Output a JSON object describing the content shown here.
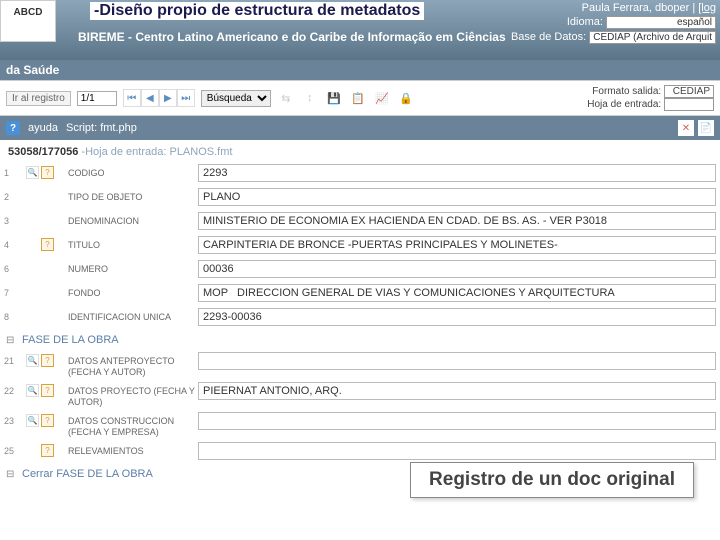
{
  "slide_title": "-Diseño propio de estructura de metadatos",
  "logo_text": "ABCD",
  "bireme": "BIREME - Centro Latino Americano e do Caribe de Informação em Ciências",
  "saude": "da Saúde",
  "user_line": "Paula Ferrara, dboper | ",
  "logout": "[log",
  "idioma_label": "Idioma:",
  "idioma_value": "español",
  "db_label": "Base de Datos:",
  "db_value": "CEDIAP (Archivo de Arquit",
  "toolbar": {
    "goto": "Ir al registro",
    "pager": "1/1",
    "search_select": "Búsqueda",
    "fmt_label": "Formato salida:",
    "fmt_value": "CEDIAP",
    "hoja_label": "Hoja de entrada:"
  },
  "script_bar": {
    "help": "ayuda",
    "script": "Script: fmt.php"
  },
  "record": {
    "counter": "53058/177056",
    "hoja": "-Hoja de entrada: PLANOS.fmt"
  },
  "fields": [
    {
      "num": "1",
      "label": "CODIGO",
      "value": "2293",
      "mg": true,
      "qm": true
    },
    {
      "num": "2",
      "label": "TIPO DE OBJETO",
      "value": "PLANO",
      "mg": false,
      "qm": false
    },
    {
      "num": "3",
      "label": "DENOMINACION",
      "value": "MINISTERIO DE ECONOMIA EX HACIENDA EN CDAD. DE BS. AS. - VER P3018",
      "mg": false,
      "qm": false
    },
    {
      "num": "4",
      "label": "TITULO",
      "value": "CARPINTERIA DE BRONCE -PUERTAS PRINCIPALES Y MOLINETES-",
      "mg": false,
      "qm": true
    },
    {
      "num": "6",
      "label": "NUMERO",
      "value": "00036",
      "mg": false,
      "qm": false
    },
    {
      "num": "7",
      "label": "FONDO",
      "value": "MOP   DIRECCION GENERAL DE VIAS Y COMUNICACIONES Y ARQUITECTURA",
      "mg": false,
      "qm": false
    },
    {
      "num": "8",
      "label": "IDENTIFICACION UNICA",
      "value": "2293-00036",
      "mg": false,
      "qm": false
    }
  ],
  "section1": "FASE DE LA OBRA",
  "fields2": [
    {
      "num": "21",
      "label": "DATOS ANTEPROYECTO (FECHA Y AUTOR)",
      "value": "",
      "mg": true,
      "qm": true
    },
    {
      "num": "22",
      "label": "DATOS PROYECTO (FECHA Y AUTOR)",
      "value": "PIEERNAT ANTONIO, ARQ.",
      "mg": true,
      "qm": true
    },
    {
      "num": "23",
      "label": "DATOS CONSTRUCCION (FECHA Y EMPRESA)",
      "value": "",
      "mg": true,
      "qm": true
    },
    {
      "num": "25",
      "label": "RELEVAMIENTOS",
      "value": "",
      "mg": false,
      "qm": true
    }
  ],
  "section_close": "Cerrar FASE DE LA OBRA",
  "caption": "Registro de un doc original"
}
